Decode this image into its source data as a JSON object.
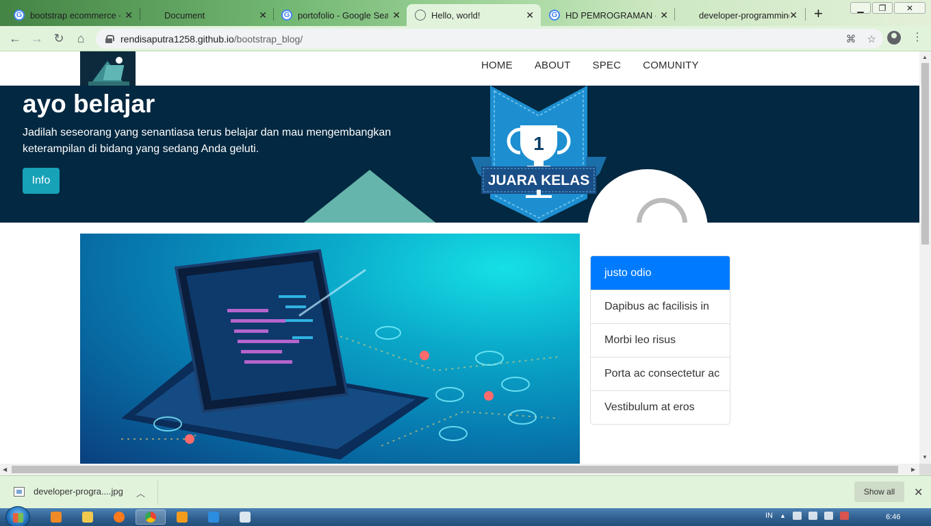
{
  "browser": {
    "tabs": [
      {
        "title": "bootstrap ecommerce - Google Search",
        "icon": "google-icon",
        "active": false
      },
      {
        "title": "Document",
        "icon": "blank-icon",
        "active": false
      },
      {
        "title": "portofolio - Google Search",
        "icon": "google-icon",
        "active": false
      },
      {
        "title": "Hello, world!",
        "icon": "globe-icon",
        "active": true
      },
      {
        "title": "HD PEMROGRAMAN - Google Search",
        "icon": "google-icon",
        "active": false
      },
      {
        "title": "developer-programming",
        "icon": "blank-icon",
        "active": false
      }
    ],
    "new_tab_symbol": "+",
    "window_controls": {
      "minimize": "▁",
      "maximize": "❐",
      "close": "✕"
    },
    "url_host": "rendisaputra1258.github.io",
    "url_path": "/bootstrap_blog/"
  },
  "page": {
    "nav": {
      "links": [
        "HOME",
        "ABOUT",
        "SPEC",
        "COMUNITY"
      ]
    },
    "hero": {
      "title": "ayo belajar",
      "text": "Jadilah seseorang yang senantiasa terus belajar dan mau mengembangkan keterampilan di bidang yang sedang Anda geluti.",
      "button": "Info",
      "badge_number": "1",
      "badge_text": "JUARA KELAS"
    },
    "list_group": [
      {
        "label": "justo odio",
        "active": true
      },
      {
        "label": "Dapibus ac facilisis in",
        "active": false
      },
      {
        "label": "Morbi leo risus",
        "active": false
      },
      {
        "label": "Porta ac consectetur ac",
        "active": false
      },
      {
        "label": "Vestibulum at eros",
        "active": false
      }
    ]
  },
  "downloads": {
    "file_name": "developer-progra....jpg",
    "show_all": "Show all"
  },
  "taskbar": {
    "language": "IN",
    "time": "6:46"
  },
  "colors": {
    "hero_bg": "#032841",
    "info_button": "#17a2b8",
    "list_active": "#007bff"
  }
}
